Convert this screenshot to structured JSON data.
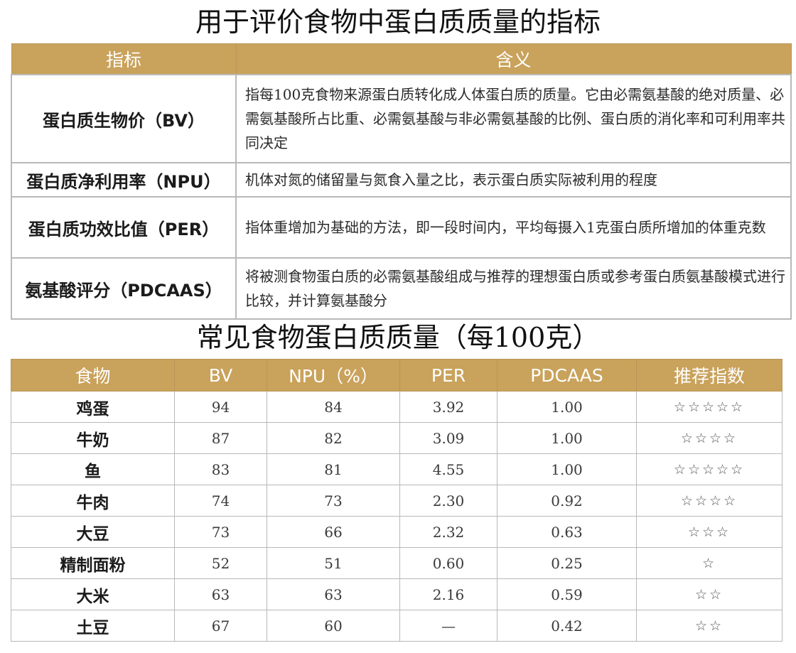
{
  "title1": "用于评价食物中蛋白质质量的指标",
  "table1": {
    "headers": [
      "指标",
      "含义"
    ],
    "rows": [
      {
        "indicator": "蛋白质生物价（BV）",
        "meaning": "指每100克食物来源蛋白质转化成人体蛋白质的质量。它由必需氨基酸的绝对质量、必需氨基酸所占比重、必需氨基酸与非必需氨基酸的比例、蛋白质的消化率和可利用率共同决定"
      },
      {
        "indicator": "蛋白质净利用率（NPU）",
        "meaning": "机体对氮的储留量与氮食入量之比，表示蛋白质实际被利用的程度"
      },
      {
        "indicator": "蛋白质功效比值（PER）",
        "meaning": "指体重增加为基础的方法，即一段时间内，平均每摄入1克蛋白质所增加的体重克数"
      },
      {
        "indicator": "氨基酸评分（PDCAAS）",
        "meaning": "将被测食物蛋白质的必需氨基酸组成与推荐的理想蛋白质或参考蛋白质氨基酸模式进行比较，并计算氨基酸分"
      }
    ]
  },
  "title2": "常见食物蛋白质质量（每100克）",
  "table2": {
    "headers": [
      "食物",
      "BV",
      "NPU（%）",
      "PER",
      "PDCAAS",
      "推荐指数"
    ],
    "rows": [
      {
        "food": "鸡蛋",
        "bv": "94",
        "npu": "84",
        "per": "3.92",
        "pdcaas": "1.00",
        "stars": "☆☆☆☆☆"
      },
      {
        "food": "牛奶",
        "bv": "87",
        "npu": "82",
        "per": "3.09",
        "pdcaas": "1.00",
        "stars": "☆☆☆☆"
      },
      {
        "food": "鱼",
        "bv": "83",
        "npu": "81",
        "per": "4.55",
        "pdcaas": "1.00",
        "stars": "☆☆☆☆☆"
      },
      {
        "food": "牛肉",
        "bv": "74",
        "npu": "73",
        "per": "2.30",
        "pdcaas": "0.92",
        "stars": "☆☆☆☆"
      },
      {
        "food": "大豆",
        "bv": "73",
        "npu": "66",
        "per": "2.32",
        "pdcaas": "0.63",
        "stars": "☆☆☆"
      },
      {
        "food": "精制面粉",
        "bv": "52",
        "npu": "51",
        "per": "0.60",
        "pdcaas": "0.25",
        "stars": "☆"
      },
      {
        "food": "大米",
        "bv": "63",
        "npu": "63",
        "per": "2.16",
        "pdcaas": "0.59",
        "stars": "☆☆"
      },
      {
        "food": "土豆",
        "bv": "67",
        "npu": "60",
        "per": "—",
        "pdcaas": "0.42",
        "stars": "☆☆"
      }
    ]
  },
  "colors": {
    "header_bg": "#c9a25b",
    "header_text": "#ffffff",
    "grid": "#b9b9b9"
  }
}
